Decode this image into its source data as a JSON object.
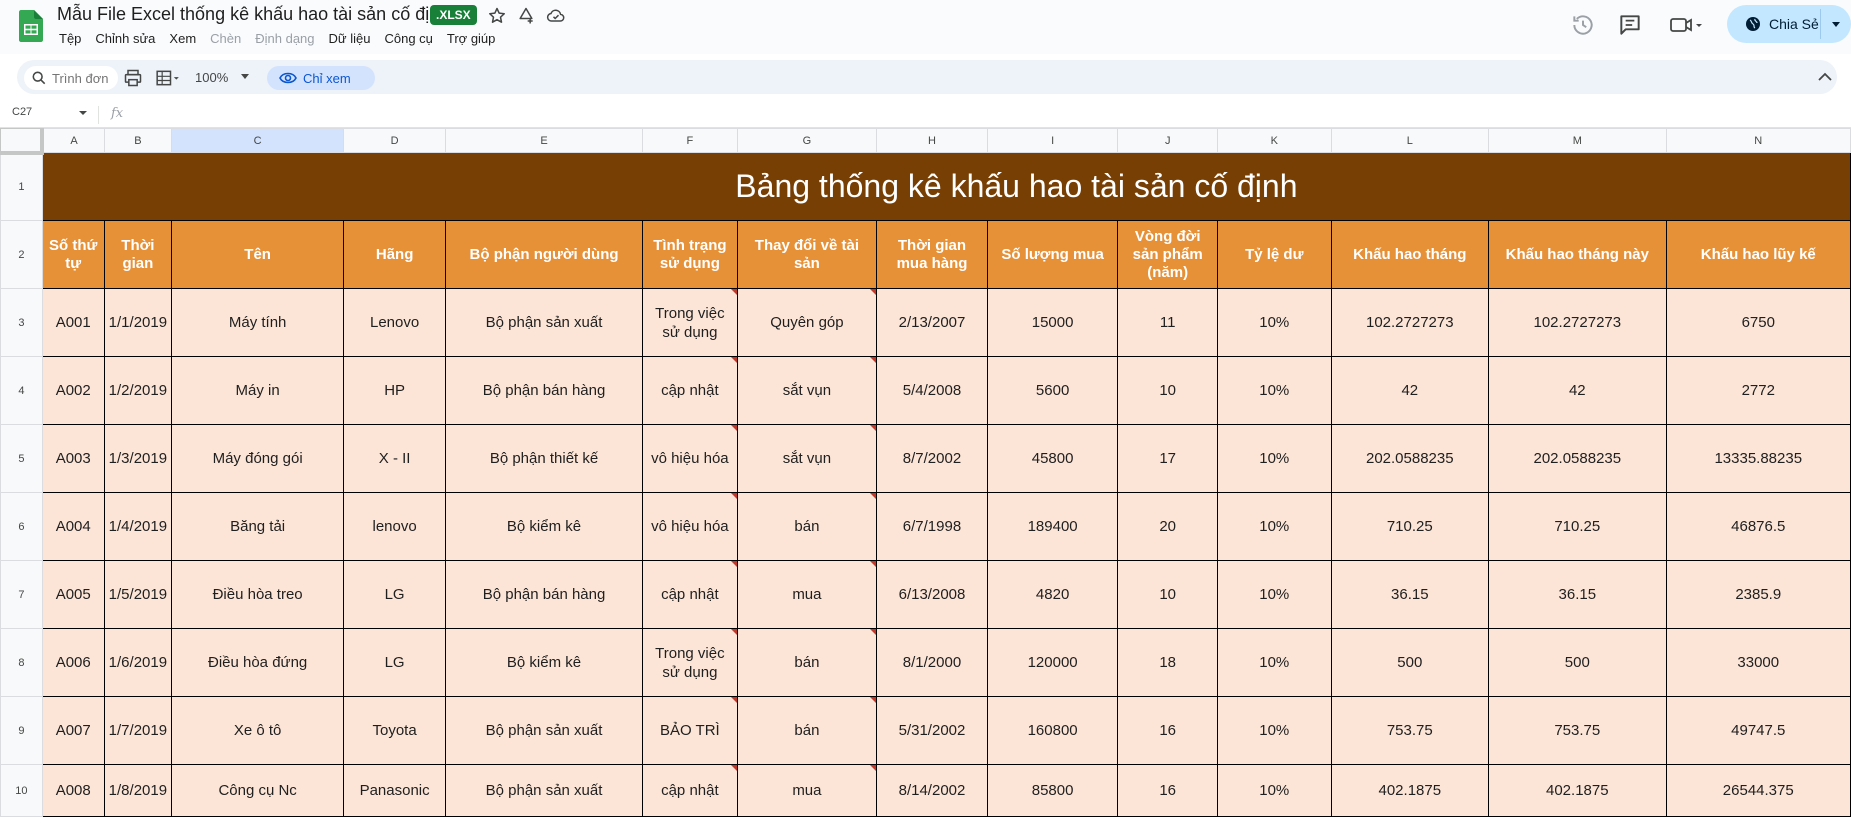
{
  "header": {
    "doc_title": "Mẫu File Excel thống kê khấu hao tài sản cố định",
    "ext_badge": ".XLSX",
    "menus": [
      {
        "label": "Tệp",
        "enabled": true
      },
      {
        "label": "Chỉnh sửa",
        "enabled": true
      },
      {
        "label": "Xem",
        "enabled": true
      },
      {
        "label": "Chèn",
        "enabled": false
      },
      {
        "label": "Định dạng",
        "enabled": false
      },
      {
        "label": "Dữ liệu",
        "enabled": true
      },
      {
        "label": "Công cụ",
        "enabled": true
      },
      {
        "label": "Trợ giúp",
        "enabled": true
      }
    ],
    "share_label": "Chia Sẻ"
  },
  "toolbar": {
    "menu_search_placeholder": "Trình đơn",
    "zoom": "100%",
    "view_only_label": "Chỉ xem"
  },
  "formula_bar": {
    "cell_ref": "C27",
    "fx_label": "fx"
  },
  "sheet": {
    "columns": [
      "A",
      "B",
      "C",
      "D",
      "E",
      "F",
      "G",
      "H",
      "I",
      "J",
      "K",
      "L",
      "M",
      "N"
    ],
    "selected_column": "C",
    "title": "Bảng thống kê khấu hao tài sản cố định",
    "headers": [
      "Số thứ tự",
      "Thời gian",
      "Tên",
      "Hãng",
      "Bộ phận người dùng",
      "Tình trạng sử dụng",
      "Thay đổi về tài sản",
      "Thời gian mua hàng",
      "Số lượng mua",
      "Vòng đời sản phẩm (năm)",
      "Tỷ lệ dư",
      "Khấu hao tháng",
      "Khấu hao tháng này",
      "Khấu hao lũy kế"
    ],
    "rows": [
      {
        "num": "3",
        "cells": [
          "A001",
          "1/1/2019",
          "Máy tính",
          "Lenovo",
          "Bộ phận sản xuất",
          "Trong việc sử dụng",
          "Quyên góp",
          "2/13/2007",
          "15000",
          "11",
          "10%",
          "102.2727273",
          "102.2727273",
          "6750"
        ]
      },
      {
        "num": "4",
        "cells": [
          "A002",
          "1/2/2019",
          "Máy in",
          "HP",
          "Bộ phận bán hàng",
          "cập nhật",
          "sắt vụn",
          "5/4/2008",
          "5600",
          "10",
          "10%",
          "42",
          "42",
          "2772"
        ]
      },
      {
        "num": "5",
        "cells": [
          "A003",
          "1/3/2019",
          "Máy đóng gói",
          "X - II",
          "Bộ phận thiết kế",
          "vô hiệu hóa",
          "sắt vụn",
          "8/7/2002",
          "45800",
          "17",
          "10%",
          "202.0588235",
          "202.0588235",
          "13335.88235"
        ]
      },
      {
        "num": "6",
        "cells": [
          "A004",
          "1/4/2019",
          "Băng tải",
          "lenovo",
          "Bộ kiểm kê",
          "vô hiệu hóa",
          "bán",
          "6/7/1998",
          "189400",
          "20",
          "10%",
          "710.25",
          "710.25",
          "46876.5"
        ]
      },
      {
        "num": "7",
        "cells": [
          "A005",
          "1/5/2019",
          "Điều hòa treo",
          "LG",
          "Bộ phận bán hàng",
          "cập nhật",
          "mua",
          "6/13/2008",
          "4820",
          "10",
          "10%",
          "36.15",
          "36.15",
          "2385.9"
        ]
      },
      {
        "num": "8",
        "cells": [
          "A006",
          "1/6/2019",
          "Điều hòa đứng",
          "LG",
          "Bộ kiểm kê",
          "Trong việc sử dụng",
          "bán",
          "8/1/2000",
          "120000",
          "18",
          "10%",
          "500",
          "500",
          "33000"
        ]
      },
      {
        "num": "9",
        "cells": [
          "A007",
          "1/7/2019",
          "Xe ô tô",
          "Toyota",
          "Bộ phận sản xuất",
          "BẢO TRÌ",
          "bán",
          "5/31/2002",
          "160800",
          "16",
          "10%",
          "753.75",
          "753.75",
          "49747.5"
        ]
      },
      {
        "num": "10",
        "cells": [
          "A008",
          "1/8/2019",
          "Công cụ Nc",
          "Panasonic",
          "Bộ phận sản xuất",
          "cập nhật",
          "mua",
          "8/14/2002",
          "85800",
          "16",
          "10%",
          "402.1875",
          "402.1875",
          "26544.375"
        ]
      }
    ]
  },
  "colors": {
    "title_bg": "#783f04",
    "header_bg": "#e69138",
    "data_bg": "#fce5d7",
    "badge_green": "#188038",
    "share_bg": "#c2e7ff"
  }
}
